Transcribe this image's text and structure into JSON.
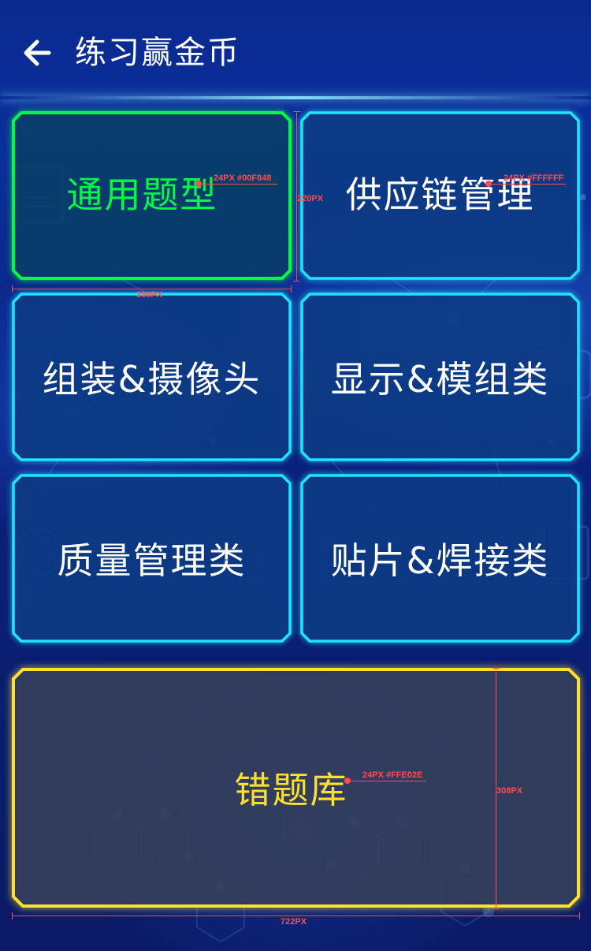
{
  "header": {
    "title": "练习赢金币",
    "back_icon": "arrow-left-icon"
  },
  "colors": {
    "accent_green": "#00F848",
    "accent_cyan": "#1FE3FF",
    "accent_yellow": "#FFE02E",
    "white": "#FFFFFF"
  },
  "categories": [
    {
      "label": "通用题型",
      "color": "#00F848",
      "selected": true
    },
    {
      "label": "供应链管理",
      "color": "#FFFFFF",
      "selected": false
    },
    {
      "label": "组装&摄像头",
      "color": "#FFFFFF",
      "selected": false
    },
    {
      "label": "显示&模组类",
      "color": "#FFFFFF",
      "selected": false
    },
    {
      "label": "质量管理类",
      "color": "#FFFFFF",
      "selected": false
    },
    {
      "label": "贴片&焊接类",
      "color": "#FFFFFF",
      "selected": false
    }
  ],
  "wrong_bank": {
    "label": "错题库",
    "color": "#FFE02E"
  },
  "annotations": {
    "green_text_spec": "24PX #00F848",
    "white_text_spec": "24PX #FFFFFF",
    "yellow_text_spec": "24PX #FFE02E",
    "card_height": "220PX",
    "card_width": "356PX",
    "bank_height": "308PX",
    "bank_width": "722PX"
  }
}
